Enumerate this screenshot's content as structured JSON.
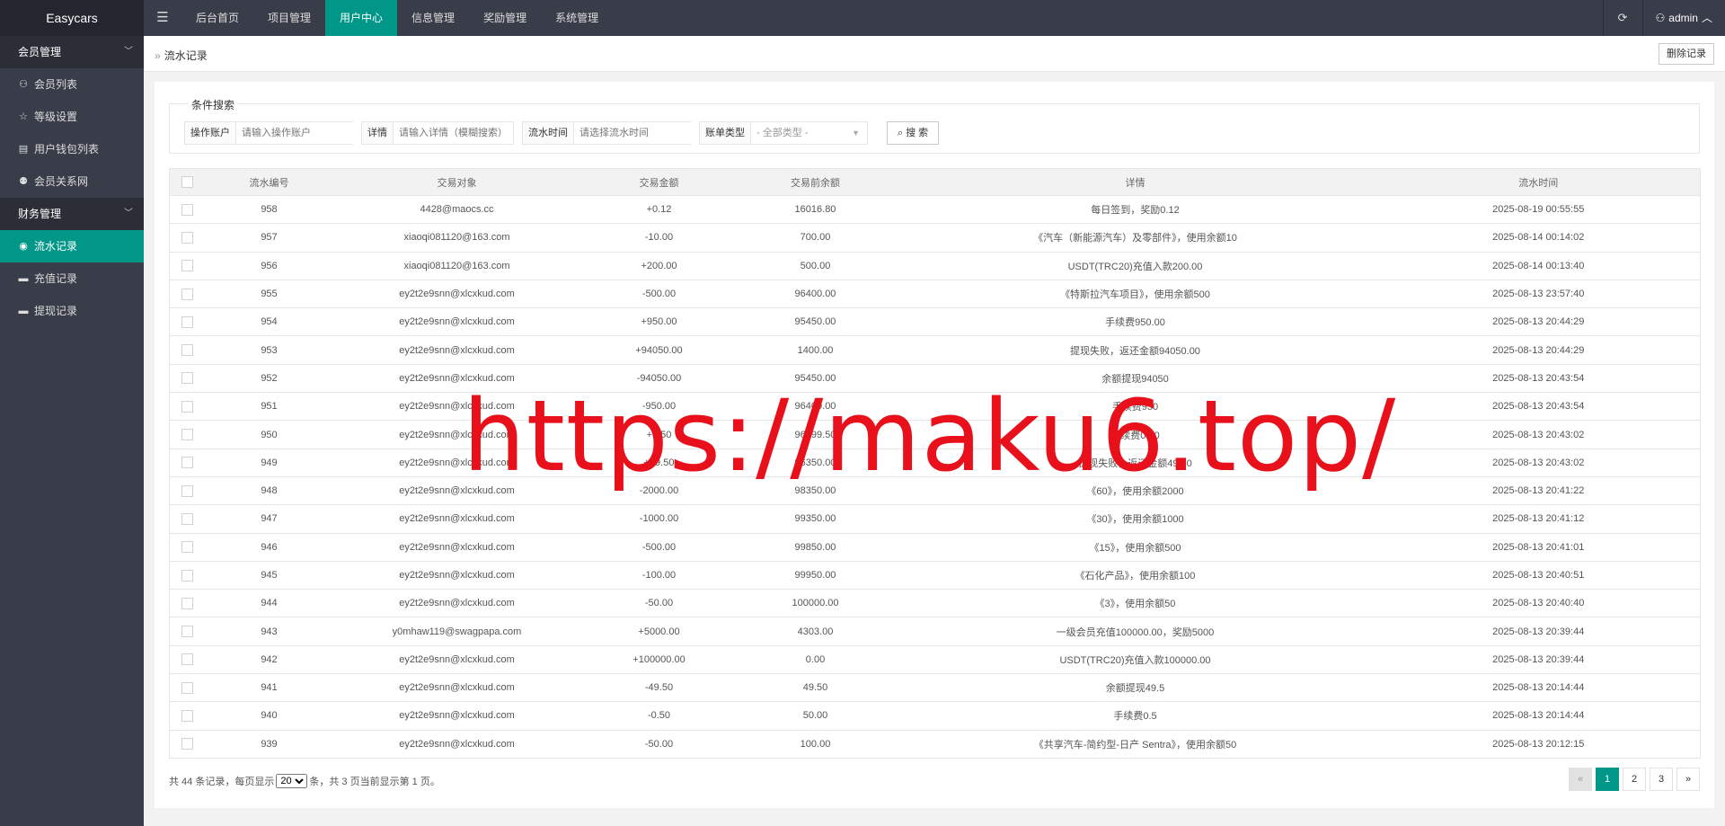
{
  "app": {
    "title": "Easycars"
  },
  "topnav": {
    "menu_icon": "hamburger-icon",
    "items": [
      {
        "label": "后台首页",
        "active": false
      },
      {
        "label": "项目管理",
        "active": false
      },
      {
        "label": "用户中心",
        "active": true
      },
      {
        "label": "信息管理",
        "active": false
      },
      {
        "label": "奖励管理",
        "active": false
      },
      {
        "label": "系统管理",
        "active": false
      }
    ],
    "refresh_icon": "refresh-icon",
    "user": "admin"
  },
  "sidebar": {
    "groups": [
      {
        "label": "会员管理",
        "items": [
          {
            "label": "会员列表",
            "icon": "user-icon"
          },
          {
            "label": "等级设置",
            "icon": "star-icon"
          },
          {
            "label": "用户钱包列表",
            "icon": "wallet-icon"
          },
          {
            "label": "会员关系网",
            "icon": "users-icon"
          }
        ]
      },
      {
        "label": "财务管理",
        "items": [
          {
            "label": "流水记录",
            "icon": "yen-icon",
            "active": true
          },
          {
            "label": "充值记录",
            "icon": "card-icon"
          },
          {
            "label": "提现记录",
            "icon": "card-icon"
          }
        ]
      }
    ]
  },
  "breadcrumb": {
    "current": "流水记录",
    "delete_label": "删除记录"
  },
  "search": {
    "legend": "条件搜索",
    "account_label": "操作账户",
    "account_placeholder": "请输入操作账户",
    "detail_label": "详情",
    "detail_placeholder": "请输入详情（模糊搜索）",
    "time_label": "流水时间",
    "time_placeholder": "请选择流水时间",
    "type_label": "账单类型",
    "type_value": "- 全部类型 -",
    "button": "搜 索"
  },
  "table": {
    "headers": [
      "流水编号",
      "交易对象",
      "交易金额",
      "交易前余额",
      "详情",
      "流水时间"
    ],
    "rows": [
      {
        "id": "958",
        "target": "4428@maocs.cc",
        "amount": "+0.12",
        "before": "16016.80",
        "detail": "每日签到，奖励0.12",
        "time": "2025-08-19 00:55:55"
      },
      {
        "id": "957",
        "target": "xiaoqi081120@163.com",
        "amount": "-10.00",
        "before": "700.00",
        "detail": "《汽车（新能源汽车）及零部件》，使用余额10",
        "time": "2025-08-14 00:14:02"
      },
      {
        "id": "956",
        "target": "xiaoqi081120@163.com",
        "amount": "+200.00",
        "before": "500.00",
        "detail": "USDT(TRC20)充值入款200.00",
        "time": "2025-08-14 00:13:40"
      },
      {
        "id": "955",
        "target": "ey2t2e9snn@xlcxkud.com",
        "amount": "-500.00",
        "before": "96400.00",
        "detail": "《特斯拉汽车项目》，使用余额500",
        "time": "2025-08-13 23:57:40"
      },
      {
        "id": "954",
        "target": "ey2t2e9snn@xlcxkud.com",
        "amount": "+950.00",
        "before": "95450.00",
        "detail": "手续费950.00",
        "time": "2025-08-13 20:44:29"
      },
      {
        "id": "953",
        "target": "ey2t2e9snn@xlcxkud.com",
        "amount": "+94050.00",
        "before": "1400.00",
        "detail": "提现失败，返还金额94050.00",
        "time": "2025-08-13 20:44:29"
      },
      {
        "id": "952",
        "target": "ey2t2e9snn@xlcxkud.com",
        "amount": "-94050.00",
        "before": "95450.00",
        "detail": "余额提现94050",
        "time": "2025-08-13 20:43:54"
      },
      {
        "id": "951",
        "target": "ey2t2e9snn@xlcxkud.com",
        "amount": "-950.00",
        "before": "96400.00",
        "detail": "手续费950",
        "time": "2025-08-13 20:43:54"
      },
      {
        "id": "950",
        "target": "ey2t2e9snn@xlcxkud.com",
        "amount": "+0.50",
        "before": "96399.50",
        "detail": "手续费0.50",
        "time": "2025-08-13 20:43:02"
      },
      {
        "id": "949",
        "target": "ey2t2e9snn@xlcxkud.com",
        "amount": "+49.50",
        "before": "96350.00",
        "detail": "提现失败，返还金额49.50",
        "time": "2025-08-13 20:43:02"
      },
      {
        "id": "948",
        "target": "ey2t2e9snn@xlcxkud.com",
        "amount": "-2000.00",
        "before": "98350.00",
        "detail": "《60》，使用余额2000",
        "time": "2025-08-13 20:41:22"
      },
      {
        "id": "947",
        "target": "ey2t2e9snn@xlcxkud.com",
        "amount": "-1000.00",
        "before": "99350.00",
        "detail": "《30》，使用余额1000",
        "time": "2025-08-13 20:41:12"
      },
      {
        "id": "946",
        "target": "ey2t2e9snn@xlcxkud.com",
        "amount": "-500.00",
        "before": "99850.00",
        "detail": "《15》，使用余额500",
        "time": "2025-08-13 20:41:01"
      },
      {
        "id": "945",
        "target": "ey2t2e9snn@xlcxkud.com",
        "amount": "-100.00",
        "before": "99950.00",
        "detail": "《石化产品》，使用余额100",
        "time": "2025-08-13 20:40:51"
      },
      {
        "id": "944",
        "target": "ey2t2e9snn@xlcxkud.com",
        "amount": "-50.00",
        "before": "100000.00",
        "detail": "《3》，使用余额50",
        "time": "2025-08-13 20:40:40"
      },
      {
        "id": "943",
        "target": "y0mhaw119@swagpapa.com",
        "amount": "+5000.00",
        "before": "4303.00",
        "detail": "一级会员充值100000.00，奖励5000",
        "time": "2025-08-13 20:39:44"
      },
      {
        "id": "942",
        "target": "ey2t2e9snn@xlcxkud.com",
        "amount": "+100000.00",
        "before": "0.00",
        "detail": "USDT(TRC20)充值入款100000.00",
        "time": "2025-08-13 20:39:44"
      },
      {
        "id": "941",
        "target": "ey2t2e9snn@xlcxkud.com",
        "amount": "-49.50",
        "before": "49.50",
        "detail": "余额提现49.5",
        "time": "2025-08-13 20:14:44"
      },
      {
        "id": "940",
        "target": "ey2t2e9snn@xlcxkud.com",
        "amount": "-0.50",
        "before": "50.00",
        "detail": "手续费0.5",
        "time": "2025-08-13 20:14:44"
      },
      {
        "id": "939",
        "target": "ey2t2e9snn@xlcxkud.com",
        "amount": "-50.00",
        "before": "100.00",
        "detail": "《共享汽车-简约型-日产 Sentra》，使用余额50",
        "time": "2025-08-13 20:12:15"
      }
    ]
  },
  "footer": {
    "prefix": "共 44 条记录，每页显示",
    "per_page": "20",
    "suffix": "条，共 3 页当前显示第 1 页。",
    "pages": [
      "«",
      "1",
      "2",
      "3",
      "»"
    ],
    "active_page": "1"
  },
  "watermark": "https://maku6.top/",
  "colors": {
    "accent": "#009688",
    "positive": "#1a9c1a",
    "negative": "#e4393c",
    "topbar": "#393d49",
    "watermark": "#e8101a"
  }
}
